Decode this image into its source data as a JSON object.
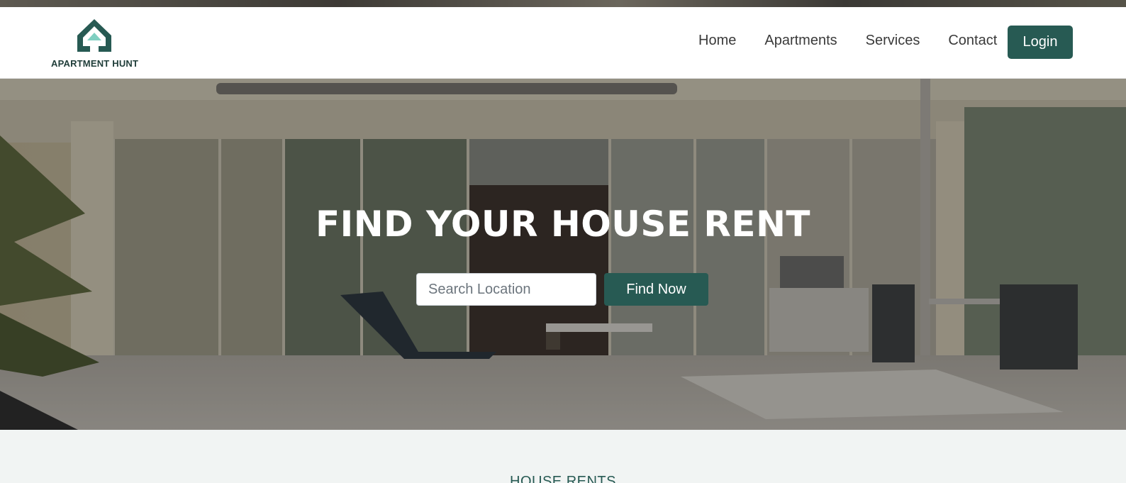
{
  "brand": {
    "name": "APARTMENT HUNT",
    "color": "#275a53",
    "logo_icon": "house-icon"
  },
  "nav": {
    "items": [
      {
        "label": "Home"
      },
      {
        "label": "Apartments"
      },
      {
        "label": "Services"
      },
      {
        "label": "Contact"
      }
    ],
    "login_label": "Login"
  },
  "hero": {
    "title": "FIND YOUR HOUSE RENT",
    "search": {
      "placeholder": "Search Location",
      "value": ""
    },
    "button_label": "Find Now",
    "background": "modern-house-patio-photo"
  },
  "section": {
    "subtitle": "HOUSE RENTS"
  }
}
